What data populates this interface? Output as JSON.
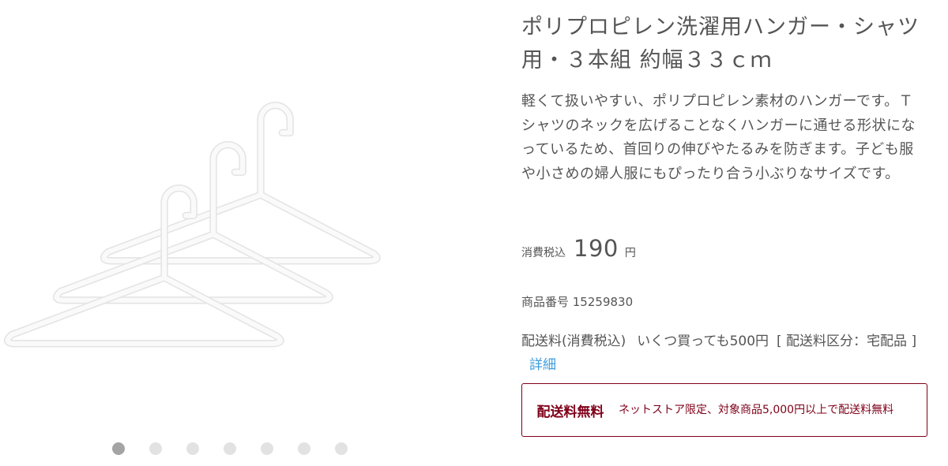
{
  "product": {
    "title": "ポリプロピレン洗濯用ハンガー・シャツ用・３本組 約幅３３ｃｍ",
    "description": "軽くて扱いやすい、ポリプロピレン素材のハンガーです。Ｔシャツのネックを広げることなくハンガーに通せる形状になっているため、首回りの伸びやたるみを防ぎます。子ども服や小さめの婦人服にもぴったり合う小ぶりなサイズです。",
    "price_label": "消費税込",
    "price": "190",
    "price_unit": "円",
    "item_number": "商品番号 15259830"
  },
  "shipping": {
    "label": "配送料(消費税込)",
    "fee": "いくつ買っても500円",
    "category": "[ 配送料区分：宅配品 ]",
    "detail_link": "詳細"
  },
  "free_shipping": {
    "title": "配送料無料",
    "text": "ネットストア限定、対象商品5,000円以上で配送料無料"
  },
  "gallery": {
    "image": "white-plastic-hangers-three-pack",
    "dot_count": 7,
    "active_index": 0
  },
  "colors": {
    "text": "#555555",
    "link": "#3f9de0",
    "accent": "#7f0019",
    "dot_active": "#a4a4a4",
    "dot_inactive": "#e2e2e2"
  }
}
